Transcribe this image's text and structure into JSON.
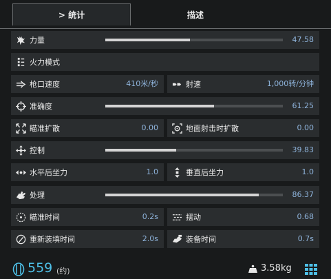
{
  "tabs": {
    "stats": "> 统计",
    "description": "描述"
  },
  "stats": {
    "power": {
      "label": "力量",
      "value": "47.58",
      "level": 0.476
    },
    "fire_mode": {
      "label": "火力模式"
    },
    "muzzle_velocity": {
      "label": "枪口速度",
      "value": "410米/秒"
    },
    "rate_of_fire": {
      "label": "射速",
      "value": "1,000转/分钟"
    },
    "accuracy": {
      "label": "准确度",
      "value": "61.25",
      "level": 0.6125
    },
    "ads_spread": {
      "label": "瞄准扩散",
      "value": "0.00"
    },
    "hip_spread": {
      "label": "地面射击时扩散",
      "value": "0.00"
    },
    "control": {
      "label": "控制",
      "value": "39.83",
      "level": 0.398
    },
    "horizontal_recoil": {
      "label": "水平后坐力",
      "value": "1.0"
    },
    "vertical_recoil": {
      "label": "垂直后坐力",
      "value": "1.0"
    },
    "handling": {
      "label": "处理",
      "value": "86.37",
      "level": 0.864
    },
    "ads_time": {
      "label": "瞄准时间",
      "value": "0.2s"
    },
    "sway": {
      "label": "摆动",
      "value": "0.68"
    },
    "reload_time": {
      "label": "重新装填时间",
      "value": "2.0s"
    },
    "equip_time": {
      "label": "装备时间",
      "value": "0.7s"
    }
  },
  "footer": {
    "cost": "559",
    "cost_note": "(约)",
    "weight": "3.58kg"
  },
  "colors": {
    "value": "#8fb4dc",
    "accent": "#4ec0e8",
    "bar_fill": "#d4d4d4",
    "bar_track": "#4c4f51"
  },
  "icons": {
    "power": "fist-burst-icon",
    "fire_mode": "fire-mode-icon",
    "muzzle_velocity": "arrow-right-icon",
    "rate_of_fire": "bullets-icon",
    "accuracy": "crosshair-icon",
    "ads_spread": "spread-arrows-icon",
    "hip_spread": "hip-target-icon",
    "control": "move-arrows-icon",
    "horizontal_recoil": "horizontal-arrows-icon",
    "vertical_recoil": "vertical-arrows-icon",
    "handling": "hand-icon",
    "ads_time": "dashed-circle-icon",
    "sway": "sway-lines-icon",
    "reload_time": "reload-icon",
    "equip_time": "equip-hand-icon",
    "cost": "cost-icon",
    "weight": "weight-icon",
    "grid": "grid-icon"
  }
}
